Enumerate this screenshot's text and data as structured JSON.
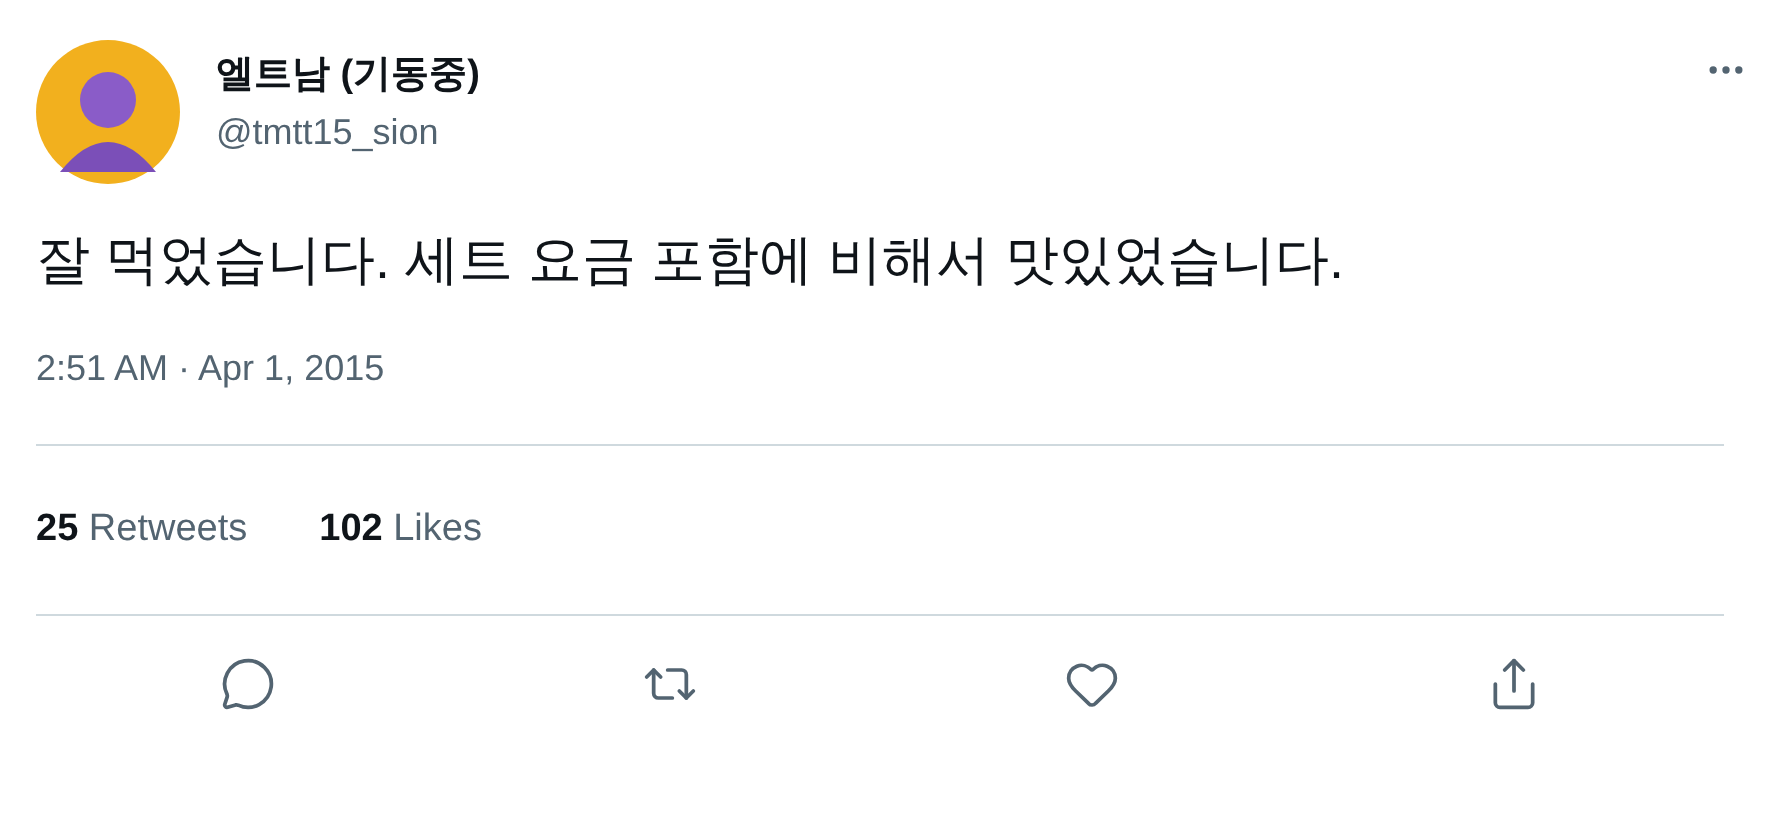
{
  "author": {
    "name": "엘트남 (기동중)",
    "handle": "@tmtt15_sion"
  },
  "tweet": {
    "text": "잘 먹었습니다. 세트 요금 포함에 비해서 맛있었습니다.",
    "time": "2:51 AM · Apr 1, 2015"
  },
  "stats": [
    {
      "count": "25",
      "label": "Retweets"
    },
    {
      "count": "102",
      "label": "Likes"
    }
  ],
  "actions": [
    {
      "kind": "reply"
    },
    {
      "kind": "retweet"
    },
    {
      "kind": "like"
    },
    {
      "kind": "share"
    }
  ]
}
